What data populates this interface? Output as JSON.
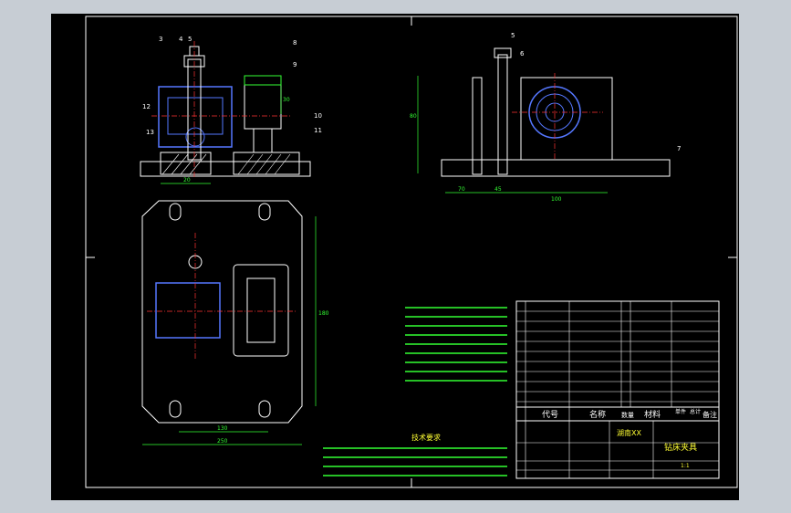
{
  "colors": {
    "background": "#c7cdd4",
    "sheet": "#000000",
    "line": "#ffffff",
    "part": "#5577ff",
    "center": "#ff3333",
    "dimension": "#33ff33",
    "table_text": "#ffff33"
  },
  "balloons": {
    "front": [
      "3",
      "4",
      "5",
      "8",
      "9",
      "10",
      "11",
      "12",
      "13"
    ],
    "side": [
      "5",
      "6",
      "7"
    ]
  },
  "dimensions": {
    "front": [
      "20",
      "30"
    ],
    "side": [
      "70",
      "45",
      "100",
      "80"
    ],
    "plan": [
      "130",
      "250",
      "180"
    ]
  },
  "notes_heading": "技术要求",
  "table": {
    "header": {
      "code": "代号",
      "name": "名称",
      "qty": "数量",
      "material": "材料",
      "unit_weight": "单件",
      "total_weight": "总计",
      "remark": "备注"
    },
    "title": "钻床夹具",
    "school": "湖南XX",
    "scale": "1:1"
  }
}
